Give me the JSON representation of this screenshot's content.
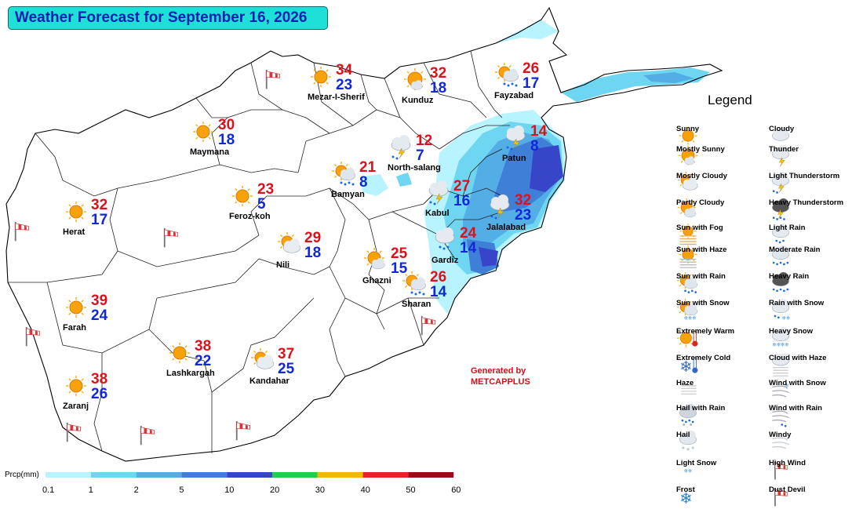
{
  "title": "Weather Forecast for September 16, 2026",
  "cities": [
    {
      "name": "Mezar-I-Sherif",
      "high": "34",
      "low": "23",
      "icon": "sunny"
    },
    {
      "name": "Kunduz",
      "high": "32",
      "low": "18",
      "icon": "mostly-sunny"
    },
    {
      "name": "Fayzabad",
      "high": "26",
      "low": "17",
      "icon": "sun-with-rain"
    },
    {
      "name": "Maymana",
      "high": "30",
      "low": "18",
      "icon": "sunny"
    },
    {
      "name": "North-salang",
      "high": "12",
      "low": "7",
      "icon": "light-thunderstorm"
    },
    {
      "name": "Patun",
      "high": "14",
      "low": "8",
      "icon": "light-thunderstorm"
    },
    {
      "name": "Bamyan",
      "high": "21",
      "low": "8",
      "icon": "sun-with-rain"
    },
    {
      "name": "Feroz-koh",
      "high": "23",
      "low": "5",
      "icon": "sunny"
    },
    {
      "name": "Kabul",
      "high": "27",
      "low": "16",
      "icon": "light-thunderstorm"
    },
    {
      "name": "Jalalabad",
      "high": "32",
      "low": "23",
      "icon": "light-thunderstorm"
    },
    {
      "name": "Herat",
      "high": "32",
      "low": "17",
      "icon": "sunny"
    },
    {
      "name": "Nili",
      "high": "29",
      "low": "18",
      "icon": "mostly-cloudy"
    },
    {
      "name": "Gardiz",
      "high": "24",
      "low": "14",
      "icon": "light-rain"
    },
    {
      "name": "Ghazni",
      "high": "25",
      "low": "15",
      "icon": "partly-cloudy"
    },
    {
      "name": "Sharan",
      "high": "26",
      "low": "14",
      "icon": "sun-with-rain"
    },
    {
      "name": "Farah",
      "high": "39",
      "low": "24",
      "icon": "sunny"
    },
    {
      "name": "Lashkargah",
      "high": "38",
      "low": "22",
      "icon": "sunny"
    },
    {
      "name": "Kandahar",
      "high": "37",
      "low": "25",
      "icon": "mostly-cloudy"
    },
    {
      "name": "Zaranj",
      "high": "38",
      "low": "26",
      "icon": "sunny"
    }
  ],
  "legend": {
    "title": "Legend",
    "items": [
      {
        "label": "Sunny",
        "icon": "sunny"
      },
      {
        "label": "Cloudy",
        "icon": "cloudy"
      },
      {
        "label": "Mostly Sunny",
        "icon": "mostly-sunny"
      },
      {
        "label": "Thunder",
        "icon": "thunder"
      },
      {
        "label": "Mostly Cloudy",
        "icon": "mostly-cloudy"
      },
      {
        "label": "Light Thunderstorm",
        "icon": "light-thunderstorm"
      },
      {
        "label": "Partly Cloudy",
        "icon": "partly-cloudy"
      },
      {
        "label": "Heavy Thunderstorm",
        "icon": "heavy-thunderstorm"
      },
      {
        "label": "Sun with Fog",
        "icon": "sun-with-fog"
      },
      {
        "label": "Light Rain",
        "icon": "light-rain"
      },
      {
        "label": "Sun with Haze",
        "icon": "sun-with-haze"
      },
      {
        "label": "Moderate Rain",
        "icon": "moderate-rain"
      },
      {
        "label": "Sun with Rain",
        "icon": "sun-with-rain"
      },
      {
        "label": "Heavy Rain",
        "icon": "heavy-rain"
      },
      {
        "label": "Sun with Snow",
        "icon": "sun-with-snow"
      },
      {
        "label": "Rain with Snow",
        "icon": "rain-with-snow"
      },
      {
        "label": "Extremely Warm",
        "icon": "extremely-warm"
      },
      {
        "label": "Heavy Snow",
        "icon": "heavy-snow"
      },
      {
        "label": "Extremely Cold",
        "icon": "extremely-cold"
      },
      {
        "label": "Cloud with Haze",
        "icon": "cloud-with-haze"
      },
      {
        "label": "Haze",
        "icon": "haze"
      },
      {
        "label": "Wind with Snow",
        "icon": "wind-with-snow"
      },
      {
        "label": "Hail with Rain",
        "icon": "hail-with-rain"
      },
      {
        "label": "Wind with Rain",
        "icon": "wind-with-rain"
      },
      {
        "label": "Hail",
        "icon": "hail"
      },
      {
        "label": "Windy",
        "icon": "windy"
      },
      {
        "label": "Light Snow",
        "icon": "light-snow"
      },
      {
        "label": "High Wind",
        "icon": "high-wind"
      },
      {
        "label": "Frost",
        "icon": "frost"
      },
      {
        "label": "Dust Devil",
        "icon": "dust-devil"
      }
    ]
  },
  "generated_by": {
    "line1": "Generated by",
    "line2": "METCAPPLUS"
  },
  "precip_scale": {
    "label": "Prcp(mm)",
    "ticks": [
      "0.1",
      "1",
      "2",
      "5",
      "10",
      "20",
      "30",
      "40",
      "50",
      "60"
    ],
    "colors": [
      "#b8f4ff",
      "#6fd6f2",
      "#54aee6",
      "#3f7fd8",
      "#3746c9",
      "#1dcf4a",
      "#f5b80a",
      "#e8202a",
      "#9a0a1a"
    ]
  },
  "colors": {
    "title_bg": "#1fe0d8",
    "title_text": "#0a1fb0",
    "high": "#e0101a",
    "low": "#1028d8",
    "rain_light": "#b8f4ff",
    "rain_mid": "#54aee6",
    "rain_heavy": "#3746c9"
  }
}
